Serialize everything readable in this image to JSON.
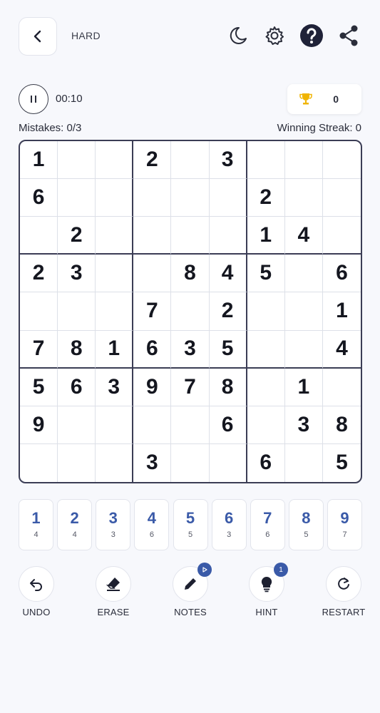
{
  "header": {
    "difficulty": "HARD"
  },
  "timer": {
    "elapsed": "00:10"
  },
  "score": {
    "value": "0"
  },
  "status": {
    "mistakes": "Mistakes: 0/3",
    "streak": "Winning Streak: 0"
  },
  "board": {
    "cells": [
      [
        "1",
        "",
        "",
        "2",
        "",
        "3",
        "",
        "",
        ""
      ],
      [
        "6",
        "",
        "",
        "",
        "",
        "",
        "2",
        "",
        ""
      ],
      [
        "",
        "2",
        "",
        "",
        "",
        "",
        "1",
        "4",
        ""
      ],
      [
        "2",
        "3",
        "",
        "",
        "8",
        "4",
        "5",
        "",
        "6"
      ],
      [
        "",
        "",
        "",
        "7",
        "",
        "2",
        "",
        "",
        "1"
      ],
      [
        "7",
        "8",
        "1",
        "6",
        "3",
        "5",
        "",
        "",
        "4"
      ],
      [
        "5",
        "6",
        "3",
        "9",
        "7",
        "8",
        "",
        "1",
        ""
      ],
      [
        "9",
        "",
        "",
        "",
        "",
        "6",
        "",
        "3",
        "8"
      ],
      [
        "",
        "",
        "",
        "3",
        "",
        "",
        "6",
        "",
        "5"
      ]
    ]
  },
  "numpad": [
    {
      "digit": "1",
      "count": "4"
    },
    {
      "digit": "2",
      "count": "4"
    },
    {
      "digit": "3",
      "count": "3"
    },
    {
      "digit": "4",
      "count": "6"
    },
    {
      "digit": "5",
      "count": "5"
    },
    {
      "digit": "6",
      "count": "3"
    },
    {
      "digit": "7",
      "count": "6"
    },
    {
      "digit": "8",
      "count": "5"
    },
    {
      "digit": "9",
      "count": "7"
    }
  ],
  "actions": {
    "undo": "UNDO",
    "erase": "ERASE",
    "notes": "NOTES",
    "hint": "HINT",
    "hint_badge": "1",
    "restart": "RESTART"
  },
  "icons": {
    "back": "chevron-left-icon",
    "theme": "moon-icon",
    "settings": "gear-icon",
    "help": "help-icon",
    "share": "share-icon",
    "pause": "pause-icon",
    "trophy": "trophy-icon",
    "undo": "undo-icon",
    "erase": "eraser-icon",
    "notes": "pencil-icon",
    "hint": "lightbulb-icon",
    "restart": "restart-icon"
  },
  "colors": {
    "accent": "#3a5aa8",
    "board_border": "#3b3d55",
    "trophy": "#f0b400"
  }
}
